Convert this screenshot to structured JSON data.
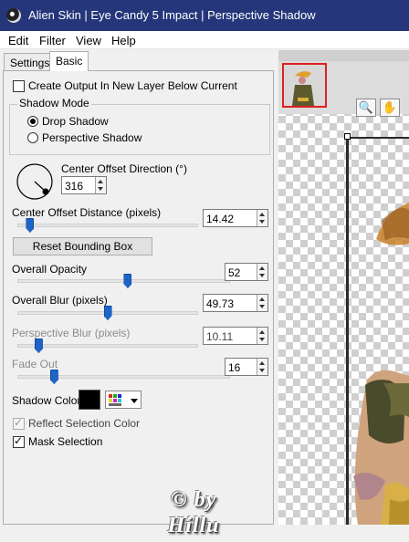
{
  "window": {
    "title": "Alien Skin | Eye Candy 5 Impact | Perspective Shadow"
  },
  "menu": [
    "Edit",
    "Filter",
    "View",
    "Help"
  ],
  "tabs": [
    "Settings",
    "Basic"
  ],
  "create_output_label": "Create Output In New Layer Below Current",
  "shadow_mode": {
    "title": "Shadow Mode",
    "options": [
      "Drop Shadow",
      "Perspective Shadow"
    ],
    "selected": "Drop Shadow"
  },
  "center_offset_direction": {
    "label": "Center Offset Direction (°)",
    "value": "316"
  },
  "center_offset_distance": {
    "label": "Center Offset Distance (pixels)",
    "value": "14.42",
    "slider": 0.05
  },
  "reset_button": "Reset Bounding Box",
  "overall_opacity": {
    "label": "Overall Opacity",
    "value": "52",
    "slider": 0.52
  },
  "overall_blur": {
    "label": "Overall Blur (pixels)",
    "value": "49.73",
    "slider": 0.5
  },
  "perspective_blur": {
    "label": "Perspective Blur (pixels)",
    "value": "10.11",
    "slider": 0.1
  },
  "fade_out": {
    "label": "Fade Out",
    "value": "16",
    "slider": 0.16
  },
  "shadow_color": {
    "label": "Shadow Color",
    "color": "#000000"
  },
  "reflect_selection": {
    "label": "Reflect Selection Color",
    "checked": true,
    "disabled": true
  },
  "mask_selection": {
    "label": "Mask Selection",
    "checked": true
  },
  "watermark": {
    "line1": "© by",
    "line2": "Hillu"
  },
  "colors": {
    "titlebar": "#25367a",
    "slider_thumb": "#1e64c8",
    "nav_highlight": "#e02020"
  },
  "icons": {
    "hand_tool": "hand-icon",
    "zoom_tool": "zoom-icon",
    "palette": "color-palette-icon"
  }
}
